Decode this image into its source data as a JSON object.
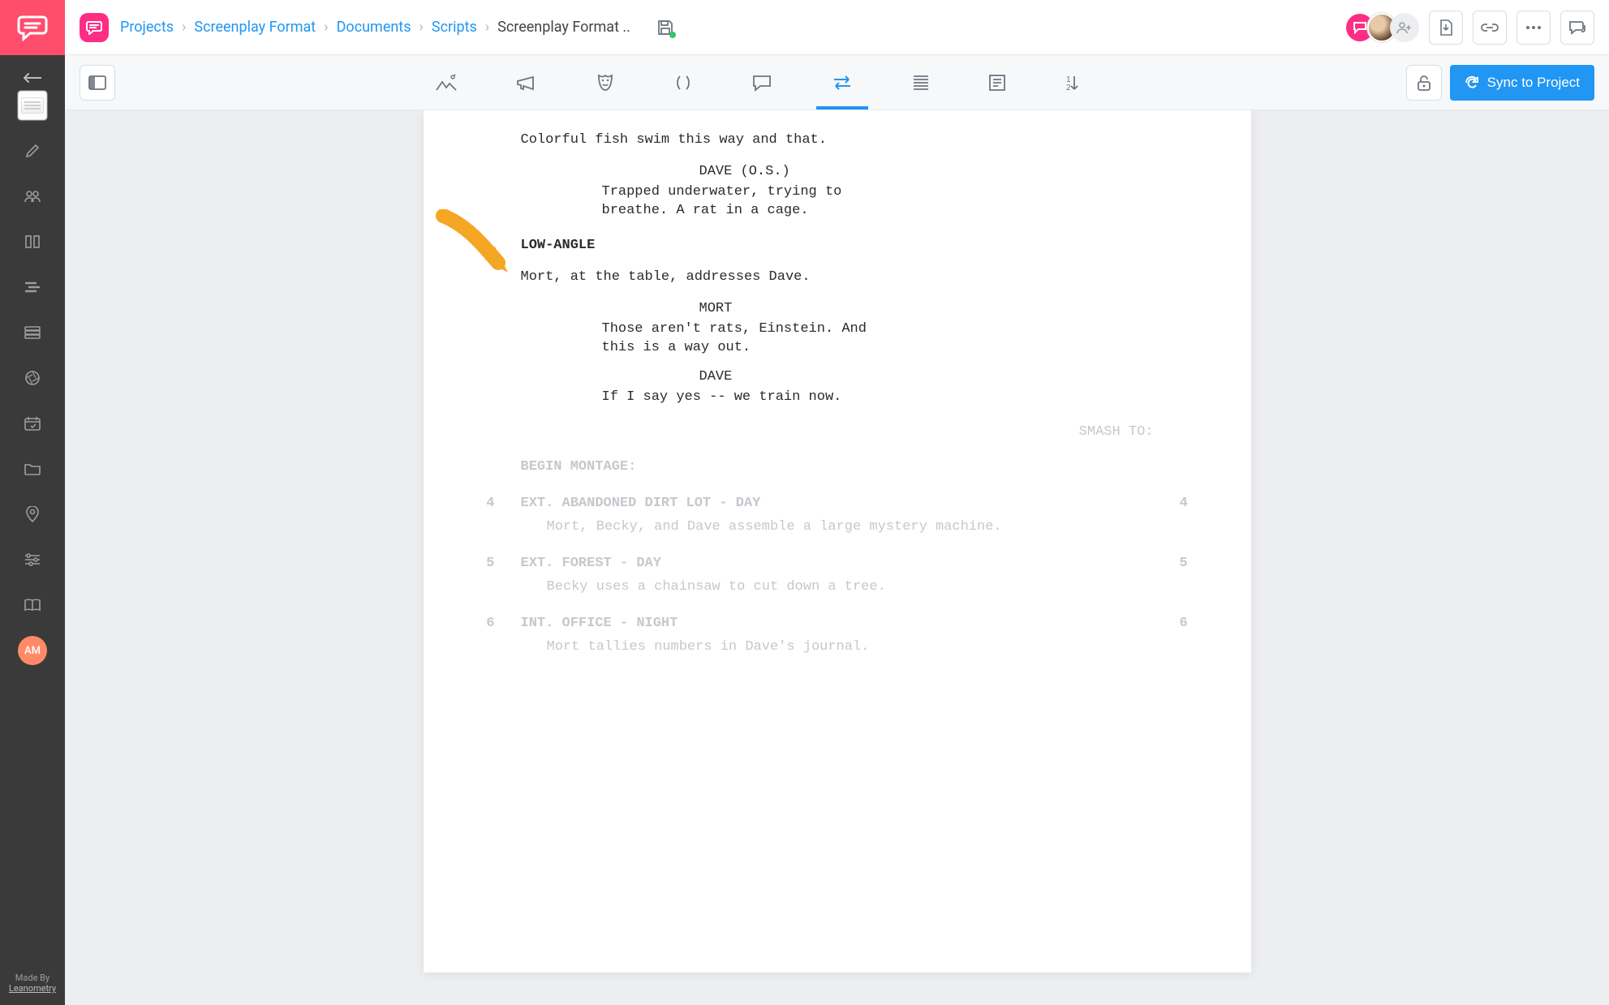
{
  "sidebar": {
    "avatar_initials": "AM",
    "footer_line1": "Made By",
    "footer_link": "Leanometry"
  },
  "breadcrumbs": {
    "item1": "Projects",
    "item2": "Screenplay Format",
    "item3": "Documents",
    "item4": "Scripts",
    "current": "Screenplay Format .."
  },
  "toolbar": {
    "sync_label": "Sync to Project"
  },
  "script": {
    "action1": "Colorful fish swim this way and that.",
    "char1": "DAVE (O.S.)",
    "dialog1a": "Trapped underwater, trying to",
    "dialog1b": "breathe. A rat in a cage.",
    "subheader1": "LOW-ANGLE",
    "action2": "Mort, at the table, addresses Dave.",
    "char2": "MORT",
    "dialog2a": "Those aren't rats, Einstein. And",
    "dialog2b": "this is a way out.",
    "char3": "DAVE",
    "dialog3": "If I say yes -- we train now.",
    "transition1": "SMASH TO:",
    "montage": "BEGIN MONTAGE:",
    "scenes": [
      {
        "num": "4",
        "heading": "EXT. ABANDONED DIRT LOT - DAY",
        "action": "Mort, Becky, and Dave assemble a large mystery machine."
      },
      {
        "num": "5",
        "heading": "EXT. FOREST - DAY",
        "action": "Becky uses a chainsaw to cut down a tree."
      },
      {
        "num": "6",
        "heading": "INT. OFFICE - NIGHT",
        "action": "Mort tallies numbers in Dave's journal."
      }
    ]
  }
}
